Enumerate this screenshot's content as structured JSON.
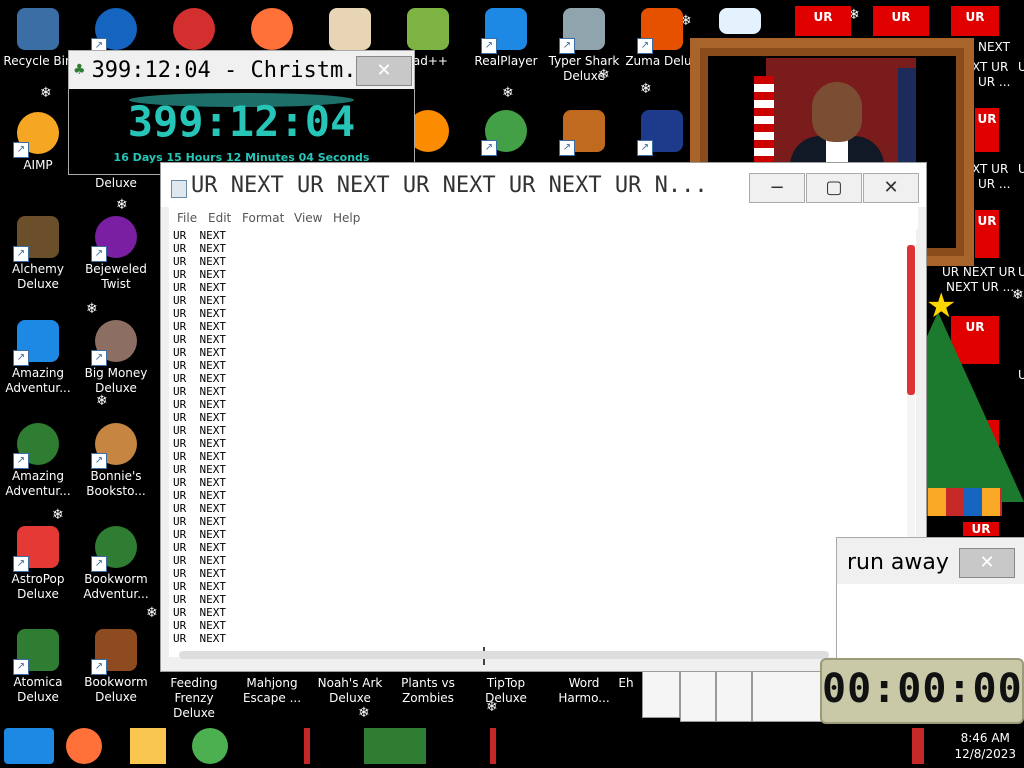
{
  "desktop_icons": [
    {
      "label": "Recycle Bin",
      "icon": "recycle-bin-icon",
      "color": "#3b6ea5"
    },
    {
      "label": "AIMP",
      "icon": "aimp-icon",
      "color": "#f5a623"
    },
    {
      "label": "Alchemy Deluxe",
      "icon": "alchemy-icon",
      "color": "#6b4f2a"
    },
    {
      "label": "Amazing Adventur...",
      "icon": "amazing-adventures-icon",
      "color": "#1e88e5"
    },
    {
      "label": "Amazing Adventur...",
      "icon": "amazing-adventures2-icon",
      "color": "#2e7d32"
    },
    {
      "label": "AstroPop Deluxe",
      "icon": "astropop-icon",
      "color": "#e53935"
    },
    {
      "label": "Atomica Deluxe",
      "icon": "atomica-icon",
      "color": "#2e7d32"
    },
    {
      "label": "",
      "icon": "game2-icon",
      "color": "#1565c0"
    },
    {
      "label": "Deluxe",
      "icon": "",
      "color": ""
    },
    {
      "label": "Bejeweled Twist",
      "icon": "bejeweled-icon",
      "color": "#7b1fa2"
    },
    {
      "label": "Big Money Deluxe",
      "icon": "money-bag-icon",
      "color": "#8d6e63"
    },
    {
      "label": "Bonnie's Booksto...",
      "icon": "bonnie-icon",
      "color": "#c68642"
    },
    {
      "label": "Bookworm Adventur...",
      "icon": "bookworm-icon",
      "color": "#2e7d32"
    },
    {
      "label": "Bookworm Deluxe",
      "icon": "bookworm-deluxe-icon",
      "color": "#8d4b1f"
    },
    {
      "label": "Feeding Frenzy Deluxe",
      "icon": "",
      "color": ""
    },
    {
      "label": "Mahjong Escape ...",
      "icon": "",
      "color": ""
    },
    {
      "label": "Noah's Ark Deluxe",
      "icon": "",
      "color": ""
    },
    {
      "label": "Plants vs Zombies",
      "icon": "",
      "color": ""
    },
    {
      "label": "TipTop Deluxe",
      "icon": "",
      "color": ""
    },
    {
      "label": "Word Harmo...",
      "icon": "",
      "color": ""
    },
    {
      "label": "tepad++",
      "icon": "notepadpp-icon",
      "color": "#7cb342"
    },
    {
      "label": "RealPlayer",
      "icon": "realplayer-icon",
      "color": "#1e88e5"
    },
    {
      "label": "Typer Shark Deluxe",
      "icon": "typer-shark-icon",
      "color": "#90a4ae"
    },
    {
      "label": "Zuma Delux",
      "icon": "zuma-icon",
      "color": "#e65100"
    },
    {
      "label": "",
      "icon": "p-game-icon",
      "color": "#fb8c00"
    },
    {
      "label": "",
      "icon": "rocket-icon",
      "color": "#43a047"
    },
    {
      "label": "",
      "icon": "boat-icon",
      "color": "#bf6a1e"
    },
    {
      "label": "",
      "icon": "xmplay-icon",
      "color": "#1e3a8a"
    },
    {
      "label": "Eh",
      "icon": "",
      "color": ""
    }
  ],
  "ur_tiles": [
    "UR",
    "UR",
    "UR",
    "UR",
    "UR",
    "UR",
    "UR",
    "UR"
  ],
  "ur_texts": [
    "NEXT",
    "XT UR",
    "UR ...",
    "XT UR",
    "UR ...",
    "UR NEXT UR",
    "NEXT UR ...",
    "UR",
    "UR",
    "UR",
    "U",
    "U",
    "U",
    "U"
  ],
  "countdown": {
    "title": "399:12:04 - Christm...",
    "time": "399:12:04",
    "detail": "16 Days 15 Hours 12 Minutes 04 Seconds"
  },
  "notepad": {
    "title": "UR NEXT UR NEXT UR NEXT UR NEXT UR N...",
    "menu": [
      "File",
      "Edit",
      "Format",
      "View",
      "Help"
    ],
    "line": "UR  NEXT",
    "line_count": 32,
    "min_glyph": "−",
    "max_glyph": "▢",
    "close_glyph": "✕"
  },
  "runaway": {
    "title": "run away",
    "close_glyph": "✕"
  },
  "timer": {
    "digits": "00:00:00"
  },
  "taskbar": {
    "time": "8:46 AM",
    "date": "12/8/2023"
  }
}
